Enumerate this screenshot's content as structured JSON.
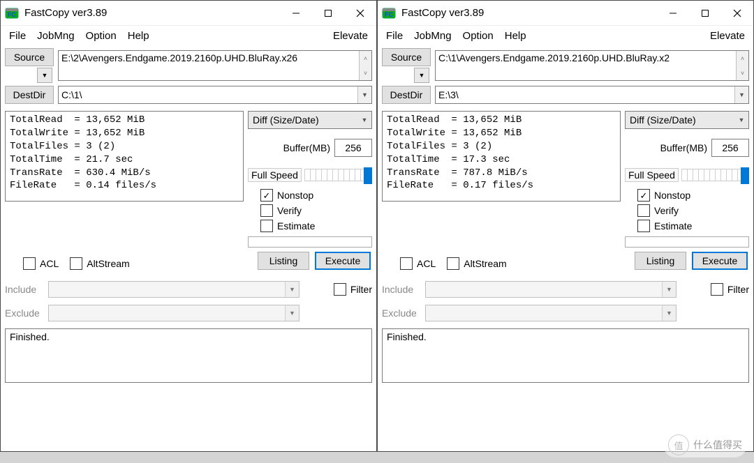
{
  "windows": [
    {
      "title": "FastCopy ver3.89",
      "menu": {
        "file": "File",
        "jobmng": "JobMng",
        "option": "Option",
        "help": "Help",
        "elevate": "Elevate"
      },
      "source_btn": "Source",
      "source_path": "E:\\2\\Avengers.Endgame.2019.2160p.UHD.BluRay.x26",
      "destdir_btn": "DestDir",
      "dest_path": "C:\\1\\",
      "stats": "TotalRead  = 13,652 MiB\nTotalWrite = 13,652 MiB\nTotalFiles = 3 (2)\nTotalTime  = 21.7 sec\nTransRate  = 630.4 MiB/s\nFileRate   = 0.14 files/s",
      "mode": "Diff (Size/Date)",
      "buffer_label": "Buffer(MB)",
      "buffer_value": "256",
      "speed_label": "Full Speed",
      "nonstop_label": "Nonstop",
      "nonstop_checked": true,
      "verify_label": "Verify",
      "verify_checked": false,
      "estimate_label": "Estimate",
      "estimate_checked": false,
      "acl_label": "ACL",
      "acl_checked": false,
      "altstream_label": "AltStream",
      "altstream_checked": false,
      "listing_btn": "Listing",
      "execute_btn": "Execute",
      "include_label": "Include",
      "exclude_label": "Exclude",
      "filter_label": "Filter",
      "filter_checked": false,
      "log": "Finished."
    },
    {
      "title": "FastCopy ver3.89",
      "menu": {
        "file": "File",
        "jobmng": "JobMng",
        "option": "Option",
        "help": "Help",
        "elevate": "Elevate"
      },
      "source_btn": "Source",
      "source_path": "C:\\1\\Avengers.Endgame.2019.2160p.UHD.BluRay.x2",
      "destdir_btn": "DestDir",
      "dest_path": "E:\\3\\",
      "stats": "TotalRead  = 13,652 MiB\nTotalWrite = 13,652 MiB\nTotalFiles = 3 (2)\nTotalTime  = 17.3 sec\nTransRate  = 787.8 MiB/s\nFileRate   = 0.17 files/s",
      "mode": "Diff (Size/Date)",
      "buffer_label": "Buffer(MB)",
      "buffer_value": "256",
      "speed_label": "Full Speed",
      "nonstop_label": "Nonstop",
      "nonstop_checked": true,
      "verify_label": "Verify",
      "verify_checked": false,
      "estimate_label": "Estimate",
      "estimate_checked": false,
      "acl_label": "ACL",
      "acl_checked": false,
      "altstream_label": "AltStream",
      "altstream_checked": false,
      "listing_btn": "Listing",
      "execute_btn": "Execute",
      "include_label": "Include",
      "exclude_label": "Exclude",
      "filter_label": "Filter",
      "filter_checked": false,
      "log": "Finished."
    }
  ],
  "watermark": "什么值得买"
}
